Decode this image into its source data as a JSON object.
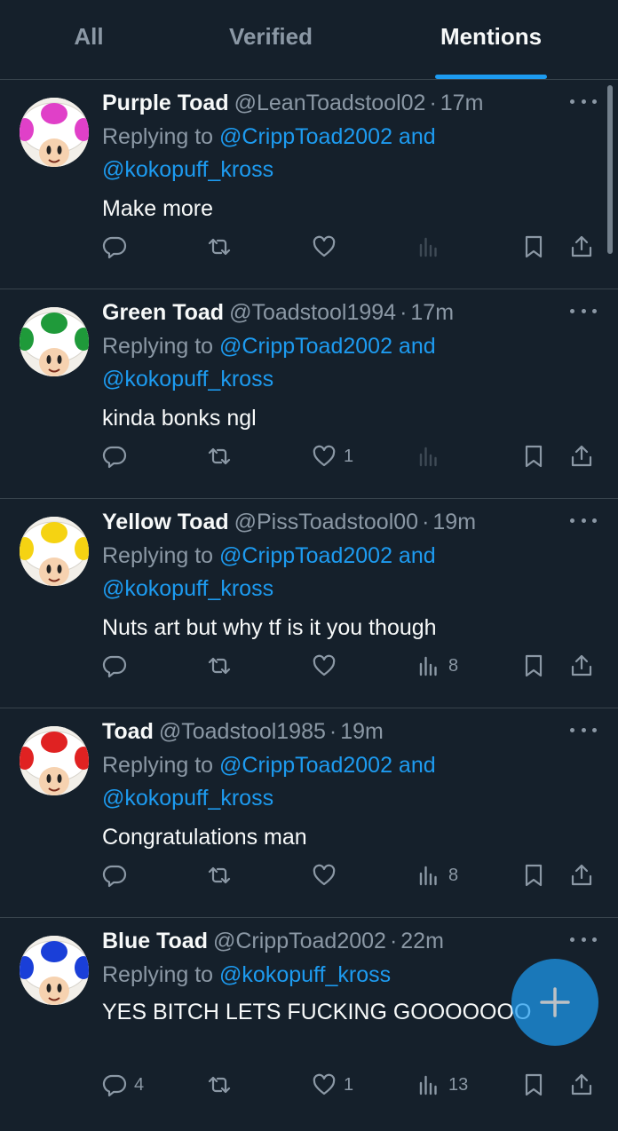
{
  "tabs": [
    {
      "label": "All",
      "active": false
    },
    {
      "label": "Verified",
      "active": false
    },
    {
      "label": "Mentions",
      "active": true
    }
  ],
  "tweets": [
    {
      "name": "Purple Toad",
      "handle": "@LeanToadstool02",
      "time": "17m",
      "replying_prefix": "Replying to ",
      "mentions_line1": "@CrippToad2002 and",
      "mentions_line2": "@kokopuff_kross",
      "text": "Make more",
      "replies": "",
      "retweets": "",
      "likes": "",
      "views": "",
      "spot_color": "#e040c8"
    },
    {
      "name": "Green Toad",
      "handle": "@Toadstool1994",
      "time": "17m",
      "replying_prefix": "Replying to ",
      "mentions_line1": "@CrippToad2002 and",
      "mentions_line2": "@kokopuff_kross",
      "text": "kinda bonks ngl",
      "replies": "",
      "retweets": "",
      "likes": "1",
      "views": "",
      "spot_color": "#1f9a3a"
    },
    {
      "name": "Yellow Toad",
      "handle": "@PissToadstool00",
      "time": "19m",
      "replying_prefix": "Replying to ",
      "mentions_line1": "@CrippToad2002 and",
      "mentions_line2": "@kokopuff_kross",
      "text": "Nuts art but why tf is it you though",
      "replies": "",
      "retweets": "",
      "likes": "",
      "views": "8",
      "spot_color": "#f5d312"
    },
    {
      "name": "Toad",
      "handle": "@Toadstool1985",
      "time": "19m",
      "replying_prefix": "Replying to ",
      "mentions_line1": "@CrippToad2002 and",
      "mentions_line2": "@kokopuff_kross",
      "text": "Congratulations man",
      "replies": "",
      "retweets": "",
      "likes": "",
      "views": "8",
      "spot_color": "#e02222"
    },
    {
      "name": "Blue Toad",
      "handle": "@CrippToad2002",
      "time": "22m",
      "replying_prefix": "Replying to ",
      "mentions_line1": "@kokopuff_kross",
      "mentions_line2": "",
      "text": "YES BITCH LETS FUCKING GOOOOOOO",
      "replies": "4",
      "retweets": "",
      "likes": "1",
      "views": "13",
      "spot_color": "#1a3fd8"
    }
  ],
  "colors": {
    "background": "#15202b",
    "accent": "#1d9bf0",
    "muted": "#8b98a5",
    "divider": "#38444d"
  },
  "fab": {
    "icon": "plus-icon"
  }
}
